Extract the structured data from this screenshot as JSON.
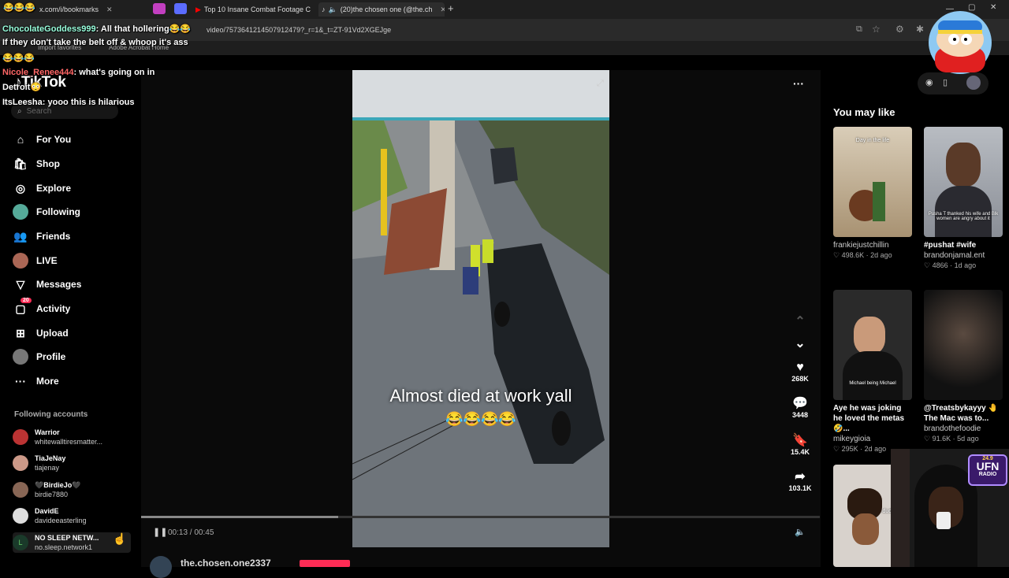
{
  "browser": {
    "tabs": [
      {
        "label": "x.com/i/bookmarks"
      },
      {
        "label": "Top 10 Insane Combat Footage C"
      },
      {
        "label": "(20)the chosen one (@the.ch"
      }
    ],
    "url": "video/7573641214507912479?_r=1&_t=ZT-91Vd2XGEJge",
    "bookmarks": [
      "Import favorites",
      "Adobe Acrobat Home"
    ]
  },
  "chat": [
    {
      "name": "ChocolateGoddess999",
      "sep": ":",
      "text": "All that hollering😂😂"
    },
    {
      "name": "",
      "sep": "",
      "text": "If they don't take the belt off & whoop it's ass"
    },
    {
      "name": "",
      "sep": "",
      "text": "😂😂😂"
    },
    {
      "name": "Nicole_Renee444",
      "sep": ":",
      "text": "what's going on in"
    },
    {
      "name": "",
      "sep": "",
      "text": "Detroit😳"
    },
    {
      "name": "ItsLeesha",
      "sep": ":",
      "text": "yooo this is hilarious"
    }
  ],
  "sidebar": {
    "logo": "TikTok",
    "search_placeholder": "Search",
    "items": [
      {
        "label": "For You",
        "icon": "home-icon"
      },
      {
        "label": "Shop",
        "icon": "shop-icon"
      },
      {
        "label": "Explore",
        "icon": "compass-icon"
      },
      {
        "label": "Following",
        "icon": "avatar"
      },
      {
        "label": "Friends",
        "icon": "friends-icon"
      },
      {
        "label": "LIVE",
        "icon": "avatar"
      },
      {
        "label": "Messages",
        "icon": "messages-icon"
      },
      {
        "label": "Activity",
        "icon": "activity-icon",
        "badge": "20"
      },
      {
        "label": "Upload",
        "icon": "upload-icon"
      },
      {
        "label": "Profile",
        "icon": "avatar"
      },
      {
        "label": "More",
        "icon": "more-icon"
      }
    ],
    "following_title": "Following accounts",
    "accounts": [
      {
        "display": "Warrior",
        "handle": "whitewalltiresmatter..."
      },
      {
        "display": "TiaJeNay",
        "handle": "tiajenay"
      },
      {
        "display": "🖤BirdieJo🖤",
        "handle": "birdie7880"
      },
      {
        "display": "DavidE",
        "handle": "davideeasterling"
      },
      {
        "display": "NO SLEEP NETW...",
        "handle": "no.sleep.network1"
      }
    ]
  },
  "video": {
    "caption": "Almost died at work yall",
    "caption_emojis": "😂😂😂😂",
    "time": "00:13 / 00:45",
    "progress": 0.29,
    "author": "the.chosen.one2337",
    "likes": "268K",
    "comments": "3448",
    "saves": "15.4K",
    "shares": "103.1K"
  },
  "rail": {
    "title": "You may like",
    "cards": [
      {
        "title": "",
        "user": "frankiejustchillin",
        "meta": "♡ 498.6K · 2d ago",
        "overlay": "Day in the life"
      },
      {
        "title": "#pushat #wife",
        "user": "brandonjamal.ent",
        "meta": "♡ 4866 · 1d ago",
        "overlay": "Pusha T thanked his wife and Blk women are angry about it"
      },
      {
        "title": "Aye he was joking he loved the metas 🤣...",
        "user": "mikeygioia",
        "meta": "♡ 295K · 2d ago",
        "overlay": "Michael being Michael"
      },
      {
        "title": "@Treatsbykayyy 🤚 The Mac was to...",
        "user": "brandothefoodie",
        "meta": "♡ 91.6K · 5d ago",
        "overlay": ""
      },
      {
        "title": "",
        "user": "",
        "meta": "",
        "overlay": "Don't be this dude"
      }
    ]
  },
  "stream": {
    "radio_freq": "24.9",
    "radio_name": "UFN",
    "radio_sub": "RADIO"
  },
  "colors": {
    "accent": "#fe2c55",
    "background": "#000000"
  }
}
